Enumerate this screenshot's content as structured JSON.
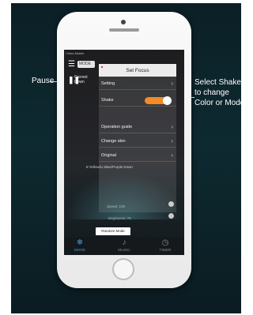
{
  "colors": {
    "accent": "#f28a26",
    "background": "#0d2a30",
    "tab_active": "#4a9fd8",
    "tab_inactive": "#8c8c8c"
  },
  "callouts": {
    "pause": "Pause",
    "shake_line1": "Select Shake",
    "shake_line2": "to change",
    "shake_line3": "Color or Mode"
  },
  "status_bar": {
    "carrier": "China Mobile"
  },
  "header": {
    "mode_button": "MODE",
    "current_label_1": "Current",
    "current_label_2": "Down"
  },
  "background_lines": [
    {
      "text": "8:Yellow/Lt Blue/Purple Down"
    },
    {
      "text": "Speed: 100"
    },
    {
      "text": "Brightness: 75"
    }
  ],
  "panel": {
    "title": "Set Focus",
    "items": [
      {
        "label": "Setting",
        "icon": "chevron-right-icon"
      },
      {
        "label": "Shake",
        "icon": "toggle-icon"
      },
      {
        "label": "Operation guide",
        "icon": "chevron-right-icon"
      },
      {
        "label": "Change skin",
        "icon": "chevron-right-icon"
      },
      {
        "label": "Original",
        "icon": "chevron-right-icon"
      }
    ],
    "shake_on": true
  },
  "random_mode_button": "Random Mode",
  "tabs": [
    {
      "label": "MODE",
      "icon": "snowflake-icon",
      "active": true
    },
    {
      "label": "MUSIC",
      "icon": "music-note-icon",
      "active": false
    },
    {
      "label": "TIMER",
      "icon": "clock-icon",
      "active": false
    }
  ]
}
